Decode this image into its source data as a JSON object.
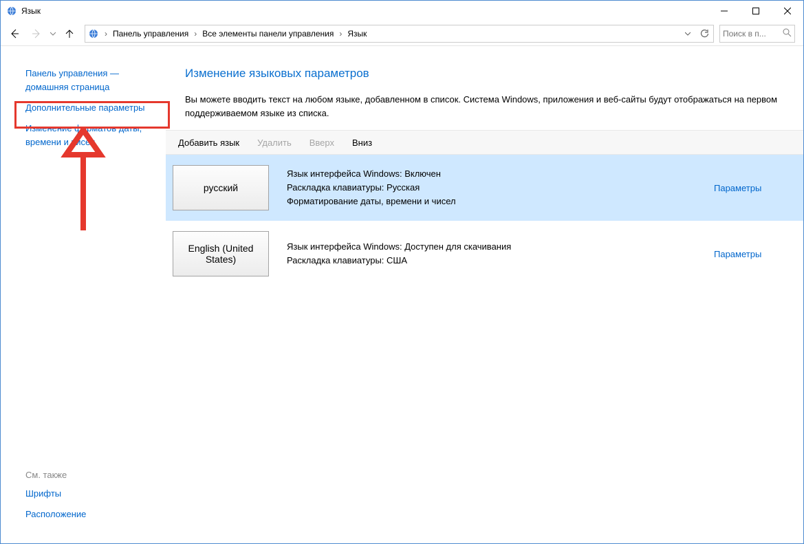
{
  "window": {
    "title": "Язык"
  },
  "breadcrumb": {
    "items": [
      "Панель управления",
      "Все элементы панели управления",
      "Язык"
    ]
  },
  "search": {
    "placeholder": "Поиск в п..."
  },
  "sidebar": {
    "links": {
      "home": "Панель управления — домашняя страница",
      "advanced": "Дополнительные параметры",
      "formats": "Изменение форматов даты, времени и чисел"
    },
    "see_also_header": "См. также",
    "see_also": {
      "fonts": "Шрифты",
      "location": "Расположение"
    }
  },
  "main": {
    "heading": "Изменение языковых параметров",
    "description": "Вы можете вводить текст на любом языке, добавленном в список. Система Windows, приложения и веб-сайты будут отображаться на первом поддерживаемом языке из списка."
  },
  "toolbar": {
    "add": "Добавить язык",
    "remove": "Удалить",
    "up": "Вверх",
    "down": "Вниз"
  },
  "languages": [
    {
      "tile": "русский",
      "lines": [
        "Язык интерфейса Windows: Включен",
        "Раскладка клавиатуры: Русская",
        "Форматирование даты, времени и чисел"
      ],
      "params": "Параметры",
      "selected": true
    },
    {
      "tile": "English (United States)",
      "lines": [
        "Язык интерфейса Windows: Доступен для скачивания",
        "Раскладка клавиатуры: США"
      ],
      "params": "Параметры",
      "selected": false
    }
  ]
}
